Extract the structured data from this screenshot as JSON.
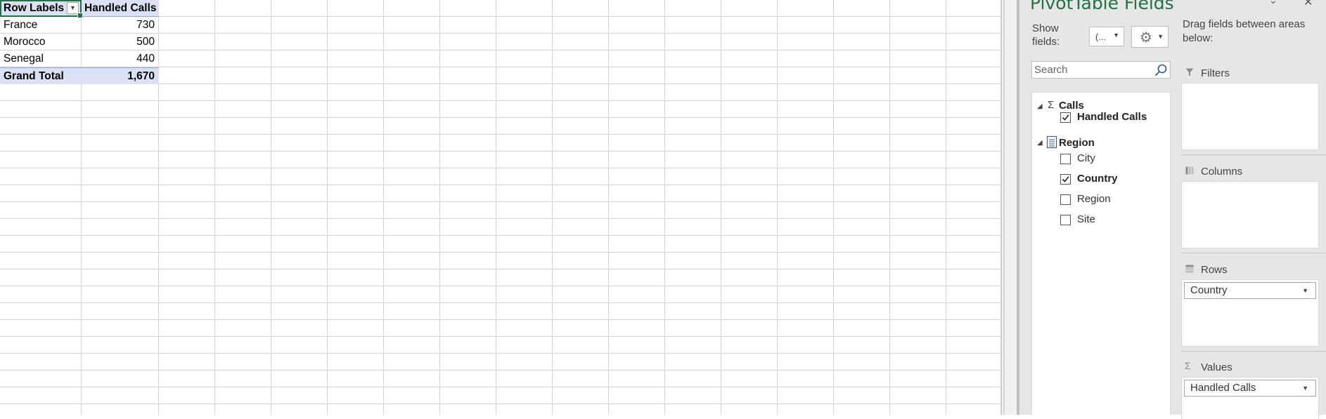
{
  "pivot_table": {
    "headers": {
      "row_labels": "Row Labels",
      "value": "Handled Calls"
    },
    "rows": [
      {
        "label": "France",
        "value": "730"
      },
      {
        "label": "Morocco",
        "value": "500"
      },
      {
        "label": "Senegal",
        "value": "440"
      }
    ],
    "total": {
      "label": "Grand Total",
      "value": "1,670"
    }
  },
  "pane": {
    "title": "PivotTable Fields",
    "show_fields_label": "Show fields:",
    "fields_dropdown_value": "(...",
    "drag_hint": "Drag fields between areas below:",
    "search_placeholder": "Search",
    "groups": [
      {
        "name": "Calls",
        "icon": "sigma-icon",
        "fields": [
          {
            "label": "Handled Calls",
            "checked": true
          }
        ]
      },
      {
        "name": "Region",
        "icon": "table-icon",
        "fields": [
          {
            "label": "City",
            "checked": false
          },
          {
            "label": "Country",
            "checked": true
          },
          {
            "label": "Region",
            "checked": false
          },
          {
            "label": "Site",
            "checked": false
          }
        ]
      }
    ],
    "areas": {
      "filters": {
        "label": "Filters"
      },
      "columns": {
        "label": "Columns"
      },
      "rows": {
        "label": "Rows",
        "item": "Country"
      },
      "values": {
        "label": "Values",
        "item": "Handled Calls"
      }
    }
  },
  "colors": {
    "accent": "#217346",
    "header_fill": "#d9e1f2"
  }
}
